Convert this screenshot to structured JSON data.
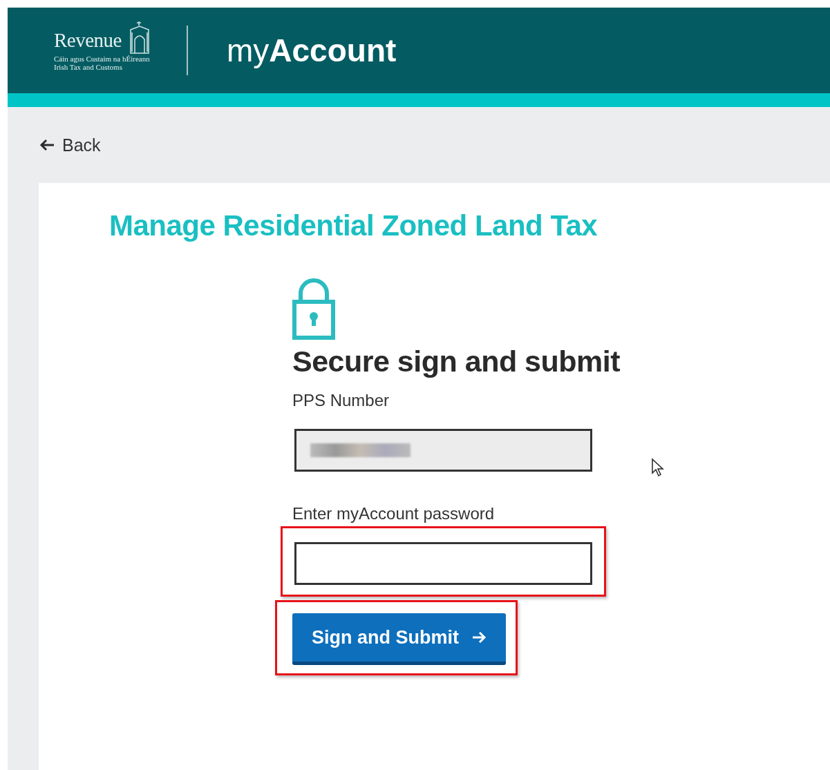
{
  "header": {
    "logo": {
      "name": "Revenue",
      "subtitle_lines": [
        "Cáin agus Custaim na hÉireann",
        "Irish Tax and Customs"
      ]
    },
    "app_title": "my**Account**"
  },
  "back_link": "Back",
  "page_title": "Manage Residential Zoned Land Tax",
  "form": {
    "heading": "Secure sign and submit",
    "fields": [
      {
        "label": "PPS Number",
        "kind": "redacted",
        "highlighted": false
      },
      {
        "label": "Enter myAccount password",
        "kind": "password",
        "highlighted": true
      }
    ],
    "button": {
      "label": "Sign and Submit",
      "highlighted": true
    }
  }
}
